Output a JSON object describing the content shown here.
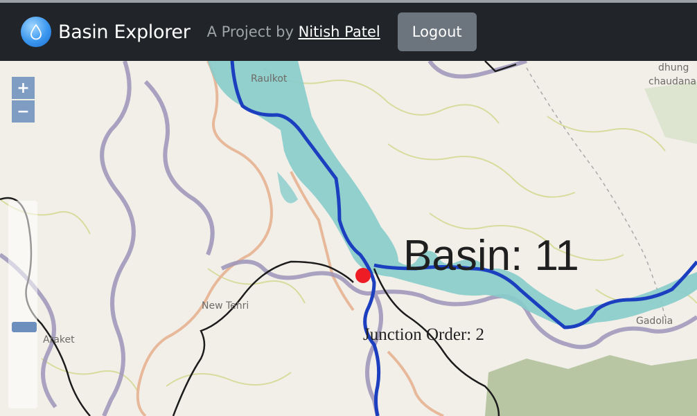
{
  "header": {
    "brand_title": "Basin Explorer",
    "tagline_prefix": "A Project by",
    "author": "Nitish Patel",
    "logout_label": "Logout",
    "logo_icon": "water-drop-icon"
  },
  "map": {
    "zoom_in_label": "+",
    "zoom_out_label": "−",
    "place_labels": [
      "Raulkot",
      "dhung",
      "chaudana",
      "New Tehri",
      "Araket",
      "Gadolia"
    ],
    "basin_label": "Basin: 11",
    "junction_label": "Junction Order: 2",
    "colors": {
      "basin_fill": "#87cccb",
      "river": "#1b3fbf",
      "boundary_purple": "#9c94b8",
      "boundary_orange": "#e7b99a",
      "roads": "#1c1c1c",
      "junction_marker": "#ee1c24",
      "land": "#f2efe9",
      "forest": "#a9bb91"
    }
  }
}
